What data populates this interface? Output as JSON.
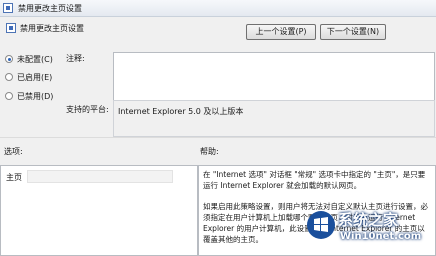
{
  "window": {
    "title": "禁用更改主页设置"
  },
  "header": {
    "setting_title": "禁用更改主页设置"
  },
  "nav": {
    "prev_label": "上一个设置(P)",
    "next_label": "下一个设置(N)"
  },
  "state_options": [
    {
      "label": "未配置(C)",
      "checked": true
    },
    {
      "label": "已启用(E)",
      "checked": false
    },
    {
      "label": "已禁用(D)",
      "checked": false
    }
  ],
  "comment": {
    "label": "注释:",
    "value": ""
  },
  "platform": {
    "label": "支持的平台:",
    "value": "Internet Explorer 5.0 及以上版本"
  },
  "options": {
    "label": "选项:",
    "home_label": "主页",
    "home_value": ""
  },
  "help": {
    "label": "帮助:",
    "paragraphs": [
      "在 \"Internet 选项\" 对话框 \"常规\" 选项卡中指定的 \"主页\"，是只要运行 Internet Explorer 就会加载的默认网页。",
      "如果启用此策略设置，则用户将无法对自定义默认主页进行设置，必须指定在用户计算机上加载哪个默认主页，对于已运行 Internet Explorer 的用户计算机，此设置将使 Internet Explorer 的主页以覆盖其他的主页。"
    ]
  },
  "watermark": {
    "main": "系统之家",
    "sub": "Win10net.com"
  },
  "colors": {
    "accent": "#2a62b8",
    "watermark_blue": "#1a3f7a"
  }
}
